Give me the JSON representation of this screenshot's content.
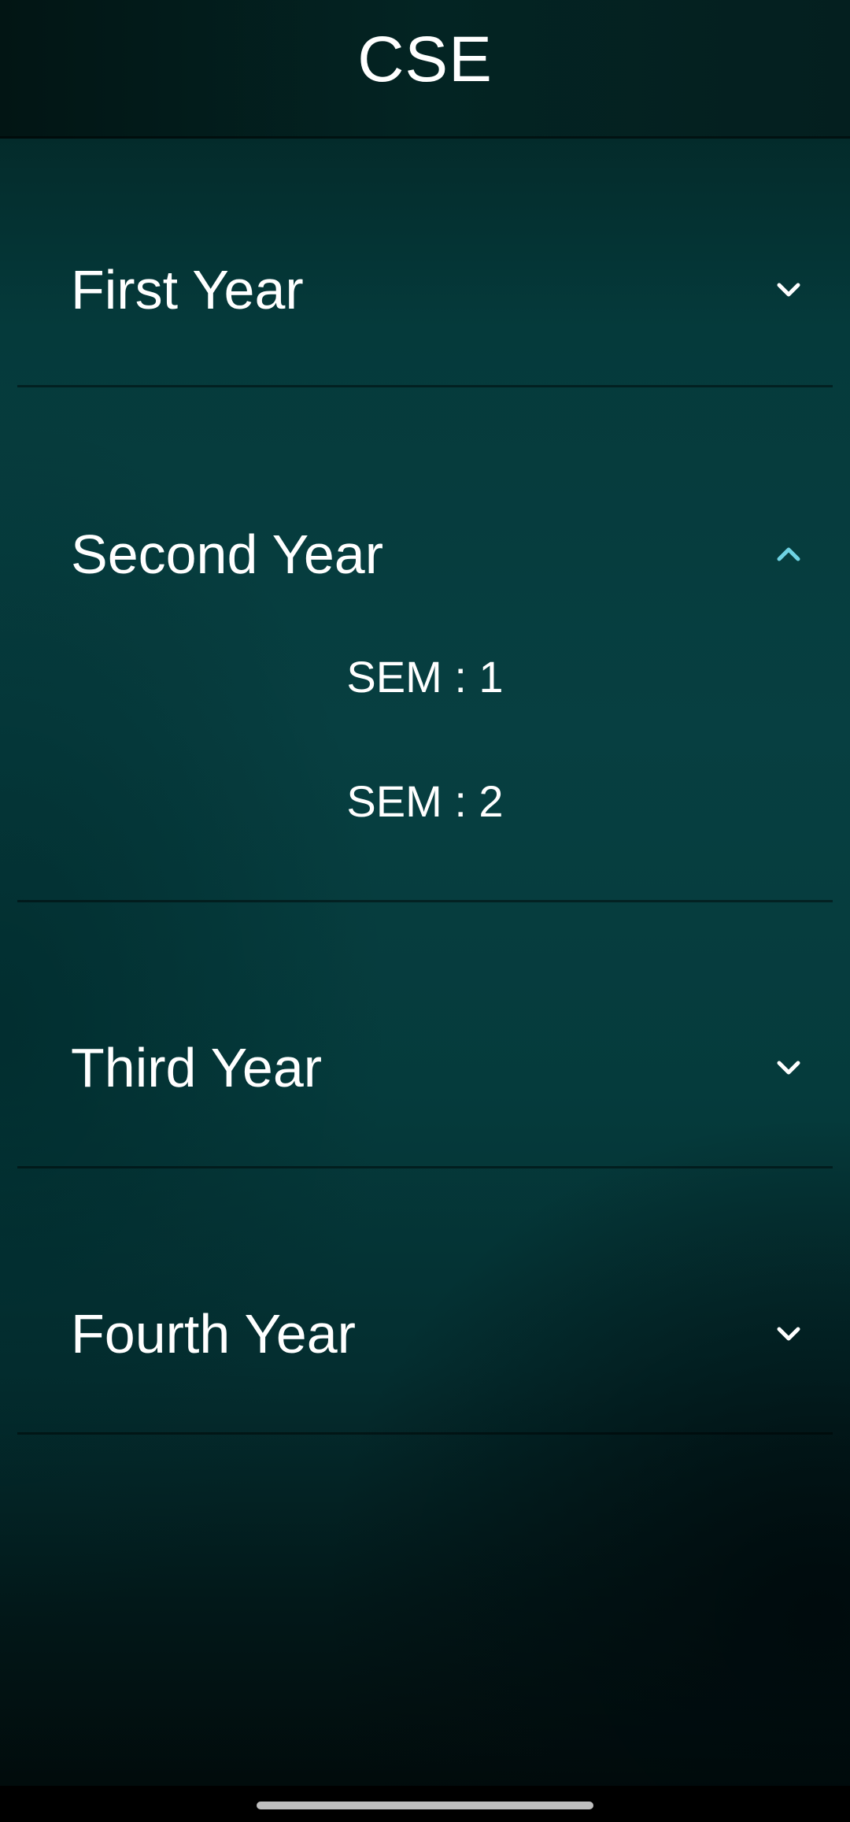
{
  "app_bar": {
    "title": "CSE"
  },
  "panels": [
    {
      "label": "First Year",
      "expanded": false,
      "icon": "chevron-down-icon"
    },
    {
      "label": "Second Year",
      "expanded": true,
      "icon": "chevron-up-icon",
      "items": [
        {
          "label": "SEM : 1"
        },
        {
          "label": "SEM : 2"
        }
      ]
    },
    {
      "label": "Third Year",
      "expanded": false,
      "icon": "chevron-down-icon"
    },
    {
      "label": "Fourth Year",
      "expanded": false,
      "icon": "chevron-down-icon"
    }
  ],
  "colors": {
    "text": "#ffffff",
    "chevron_collapsed": "#ffffff",
    "chevron_expanded": "#6fd3e3",
    "background": "#053a3b",
    "divider": "#000000"
  }
}
